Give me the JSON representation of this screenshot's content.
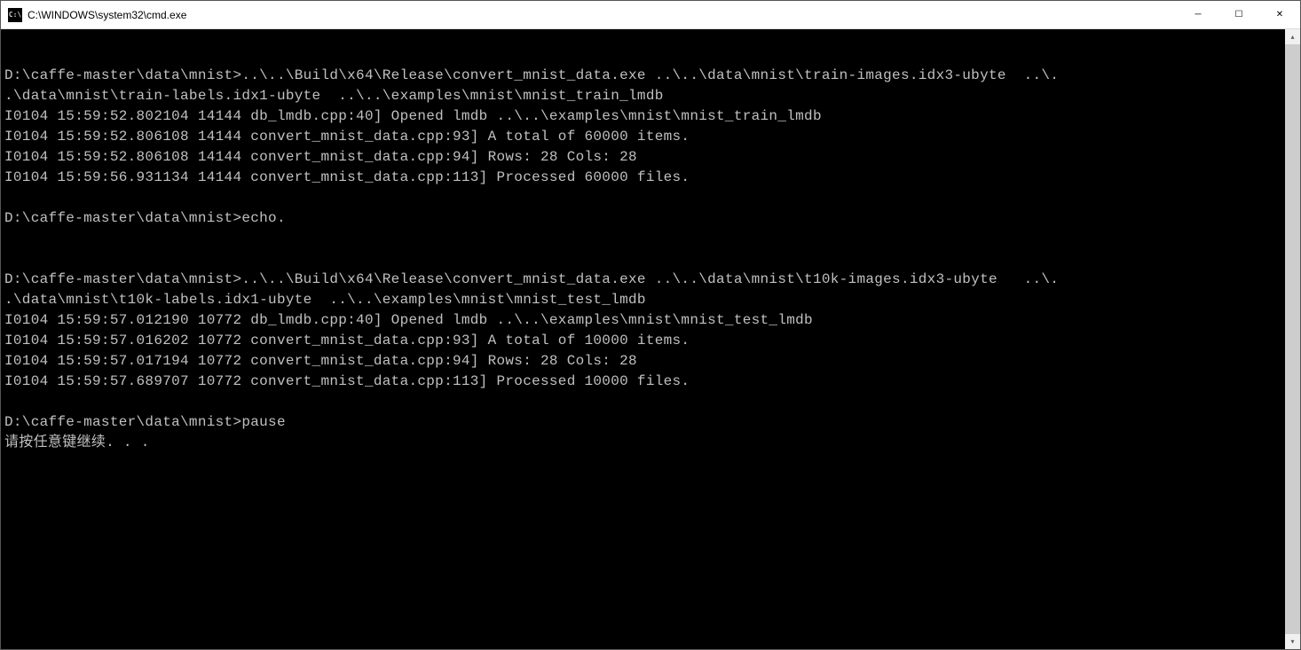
{
  "window": {
    "title": "C:\\WINDOWS\\system32\\cmd.exe",
    "icon_label": "C:\\"
  },
  "controls": {
    "minimize": "─",
    "maximize": "☐",
    "close": "✕"
  },
  "scrollbar": {
    "up": "▴",
    "down": "▾"
  },
  "console": {
    "lines": [
      "",
      "D:\\caffe-master\\data\\mnist>..\\..\\Build\\x64\\Release\\convert_mnist_data.exe ..\\..\\data\\mnist\\train-images.idx3-ubyte  ..\\.",
      ".\\data\\mnist\\train-labels.idx1-ubyte  ..\\..\\examples\\mnist\\mnist_train_lmdb",
      "I0104 15:59:52.802104 14144 db_lmdb.cpp:40] Opened lmdb ..\\..\\examples\\mnist\\mnist_train_lmdb",
      "I0104 15:59:52.806108 14144 convert_mnist_data.cpp:93] A total of 60000 items.",
      "I0104 15:59:52.806108 14144 convert_mnist_data.cpp:94] Rows: 28 Cols: 28",
      "I0104 15:59:56.931134 14144 convert_mnist_data.cpp:113] Processed 60000 files.",
      "",
      "D:\\caffe-master\\data\\mnist>echo.",
      "",
      "",
      "D:\\caffe-master\\data\\mnist>..\\..\\Build\\x64\\Release\\convert_mnist_data.exe ..\\..\\data\\mnist\\t10k-images.idx3-ubyte   ..\\.",
      ".\\data\\mnist\\t10k-labels.idx1-ubyte  ..\\..\\examples\\mnist\\mnist_test_lmdb",
      "I0104 15:59:57.012190 10772 db_lmdb.cpp:40] Opened lmdb ..\\..\\examples\\mnist\\mnist_test_lmdb",
      "I0104 15:59:57.016202 10772 convert_mnist_data.cpp:93] A total of 10000 items.",
      "I0104 15:59:57.017194 10772 convert_mnist_data.cpp:94] Rows: 28 Cols: 28",
      "I0104 15:59:57.689707 10772 convert_mnist_data.cpp:113] Processed 10000 files.",
      "",
      "D:\\caffe-master\\data\\mnist>pause",
      "请按任意键继续. . ."
    ]
  }
}
